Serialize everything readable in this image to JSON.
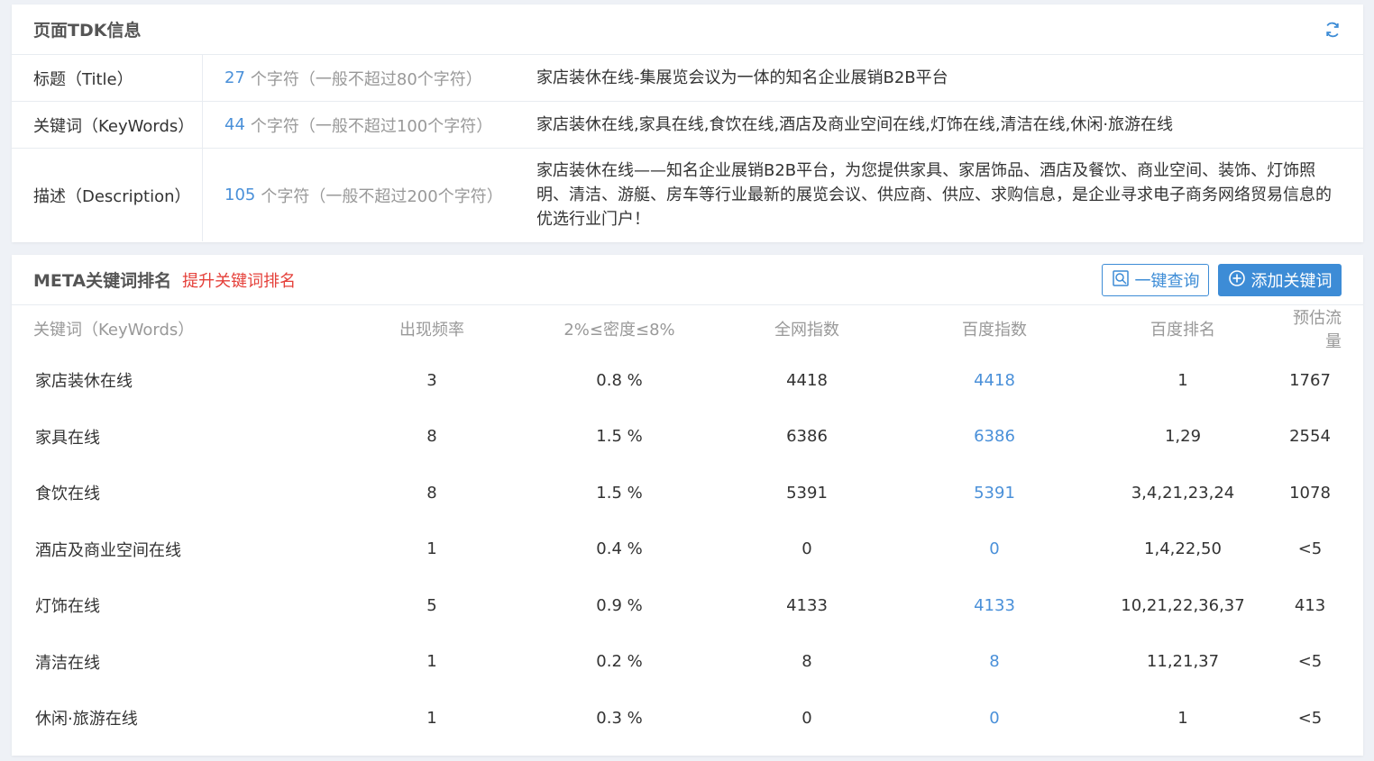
{
  "tdk": {
    "title": "页面TDK信息",
    "rows": [
      {
        "label": "标题（Title）",
        "count": "27",
        "count_text": "个字符（一般不超过80个字符）",
        "content": "家店装休在线-集展览会议为一体的知名企业展销B2B平台"
      },
      {
        "label": "关键词（KeyWords）",
        "count": "44",
        "count_text": "个字符（一般不超过100个字符）",
        "content": "家店装休在线,家具在线,食饮在线,酒店及商业空间在线,灯饰在线,清洁在线,休闲·旅游在线"
      },
      {
        "label": "描述（Description）",
        "count": "105",
        "count_text": "个字符（一般不超过200个字符）",
        "content": "家店装休在线——知名企业展销B2B平台，为您提供家具、家居饰品、酒店及餐饮、商业空间、装饰、灯饰照明、清洁、游艇、房车等行业最新的展览会议、供应商、供应、求购信息，是企业寻求电子商务网络贸易信息的优选行业门户！"
      }
    ]
  },
  "meta": {
    "title": "META关键词排名",
    "promote_link": "提升关键词排名",
    "query_button": "一键查询",
    "add_button": "添加关键词",
    "headers": [
      "关键词（KeyWords）",
      "出现频率",
      "2%≤密度≤8%",
      "全网指数",
      "百度指数",
      "百度排名",
      "预估流量"
    ],
    "rows": [
      {
        "keyword": "家店装休在线",
        "freq": "3",
        "density": "0.8 %",
        "all_index": "4418",
        "baidu_index": "4418",
        "baidu_rank": "1",
        "traffic": "1767"
      },
      {
        "keyword": "家具在线",
        "freq": "8",
        "density": "1.5 %",
        "all_index": "6386",
        "baidu_index": "6386",
        "baidu_rank": "1,29",
        "traffic": "2554"
      },
      {
        "keyword": "食饮在线",
        "freq": "8",
        "density": "1.5 %",
        "all_index": "5391",
        "baidu_index": "5391",
        "baidu_rank": "3,4,21,23,24",
        "traffic": "1078"
      },
      {
        "keyword": "酒店及商业空间在线",
        "freq": "1",
        "density": "0.4 %",
        "all_index": "0",
        "baidu_index": "0",
        "baidu_rank": "1,4,22,50",
        "traffic": "<5"
      },
      {
        "keyword": "灯饰在线",
        "freq": "5",
        "density": "0.9 %",
        "all_index": "4133",
        "baidu_index": "4133",
        "baidu_rank": "10,21,22,36,37",
        "traffic": "413"
      },
      {
        "keyword": "清洁在线",
        "freq": "1",
        "density": "0.2 %",
        "all_index": "8",
        "baidu_index": "8",
        "baidu_rank": "11,21,37",
        "traffic": "<5"
      },
      {
        "keyword": "休闲·旅游在线",
        "freq": "1",
        "density": "0.3 %",
        "all_index": "0",
        "baidu_index": "0",
        "baidu_rank": "1",
        "traffic": "<5"
      }
    ]
  },
  "colors": {
    "accent": "#3d8cd6",
    "link": "#4a90d9",
    "warning": "#e5403a"
  },
  "icons": {
    "refresh": "refresh-icon",
    "search": "search-icon",
    "add": "plus-circle-icon"
  }
}
